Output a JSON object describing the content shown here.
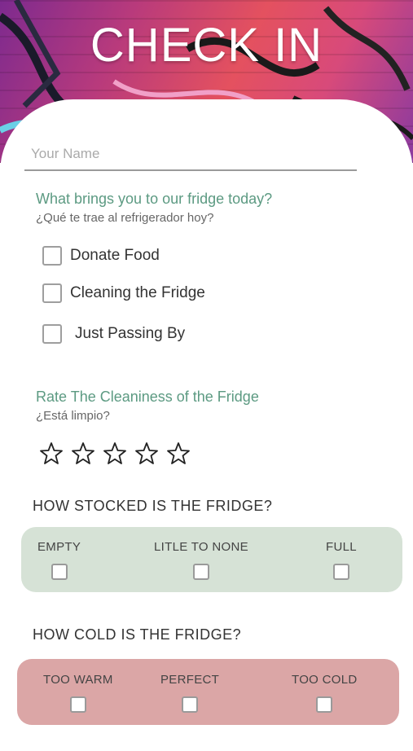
{
  "header": {
    "title": "CHECK IN"
  },
  "name_field": {
    "placeholder": "Your Name",
    "value": ""
  },
  "purpose": {
    "title": "What brings you to our fridge today?",
    "subtitle": "¿Qué te trae al refrigerador hoy?",
    "options": [
      "Donate Food",
      "Cleaning the Fridge",
      "Just Passing By"
    ]
  },
  "cleanliness": {
    "title": "Rate The Cleaniness of the Fridge",
    "subtitle": "¿Está limpio?",
    "rating": 0,
    "max_rating": 5
  },
  "stocked": {
    "title": "HOW STOCKED IS THE FRIDGE?",
    "options": [
      "EMPTY",
      "LITLE TO NONE",
      "FULL"
    ]
  },
  "cold": {
    "title": "HOW COLD IS THE FRIDGE?",
    "options": [
      "TOO WARM",
      "PERFECT",
      "TOO COLD"
    ]
  },
  "colors": {
    "accent_text": "#5c9a82",
    "stocked_panel": "#d6e2d6",
    "cold_panel": "#dba6a6"
  }
}
